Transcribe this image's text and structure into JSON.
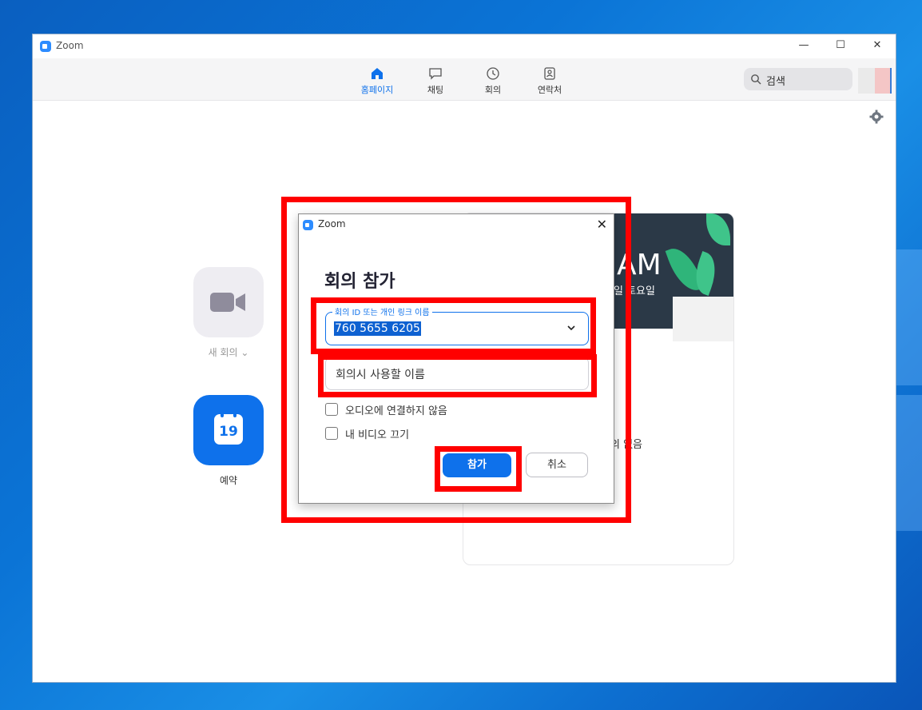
{
  "window": {
    "title": "Zoom",
    "minimize": "—",
    "maximize": "☐",
    "close": "✕"
  },
  "nav": {
    "home": "홈페이지",
    "chat": "채팅",
    "meetings": "회의",
    "contacts": "연락처",
    "search_placeholder": "검색"
  },
  "main": {
    "new_meeting": "새 회의 ⌄",
    "schedule": "예약",
    "calendar_day": "19"
  },
  "card": {
    "time": "AM",
    "date": "일 토요일",
    "partial_text": "의 없음"
  },
  "dialog": {
    "title": "Zoom",
    "close": "✕",
    "heading": "회의 참가",
    "id_label": "회의 ID 또는 개인 링크 이름",
    "id_value": "760 5655 6205",
    "name_placeholder": "회의시 사용할 이름",
    "no_audio_label": "오디오에 연결하지 않음",
    "video_off_label": "내 비디오 끄기",
    "join_button": "참가",
    "cancel_button": "취소"
  },
  "colors": {
    "accent": "#0e71eb",
    "highlight": "#ff0000"
  }
}
